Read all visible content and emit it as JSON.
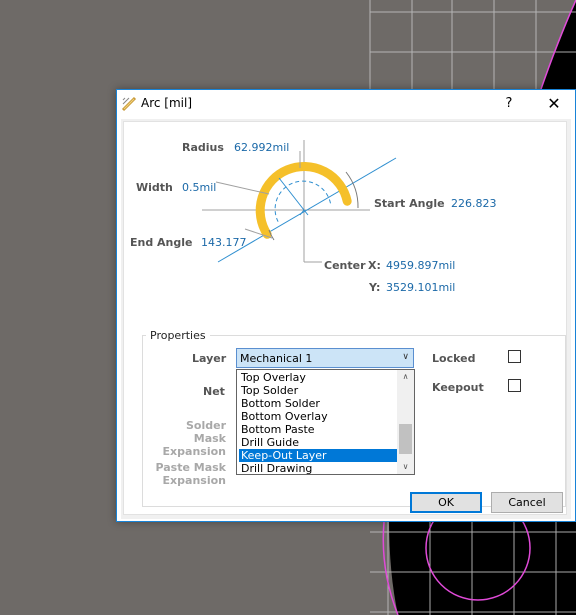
{
  "dialog": {
    "title": "Arc [mil]",
    "help_label": "?",
    "close_label": "✕"
  },
  "diagram": {
    "radius_label": "Radius",
    "radius_value": "62.992mil",
    "width_label": "Width",
    "width_value": "0.5mil",
    "start_angle_label": "Start Angle",
    "start_angle_value": "226.823",
    "end_angle_label": "End Angle",
    "end_angle_value": "143.177",
    "center_label": "Center",
    "center_x_label": "X:",
    "center_x_value": "4959.897mil",
    "center_y_label": "Y:",
    "center_y_value": "3529.101mil",
    "arc_color": "#f5c02a",
    "line_color": "#2f8fd0"
  },
  "properties": {
    "legend": "Properties",
    "layer_label": "Layer",
    "layer_value": "Mechanical 1",
    "net_label": "Net",
    "solder_mask_label_1": "Solder Mask",
    "solder_mask_label_2": "Expansion",
    "paste_mask_label_1": "Paste Mask",
    "paste_mask_label_2": "Expansion",
    "locked_label": "Locked",
    "locked_checked": false,
    "keepout_label": "Keepout",
    "keepout_checked": false,
    "layer_options": [
      {
        "label": "Top Overlay",
        "selected": false
      },
      {
        "label": "Top Solder",
        "selected": false
      },
      {
        "label": "Bottom Solder",
        "selected": false
      },
      {
        "label": "Bottom Overlay",
        "selected": false
      },
      {
        "label": "Bottom Paste",
        "selected": false
      },
      {
        "label": "Drill Guide",
        "selected": false
      },
      {
        "label": "Keep-Out Layer",
        "selected": true
      },
      {
        "label": "Drill Drawing",
        "selected": false
      }
    ]
  },
  "buttons": {
    "ok": "OK",
    "cancel": "Cancel"
  },
  "colors": {
    "canvas_background": "#6e6a67",
    "board_black": "#000000",
    "grid": "#bdbdbd",
    "board_outline": "#e04ad8",
    "accent": "#0078d7"
  }
}
